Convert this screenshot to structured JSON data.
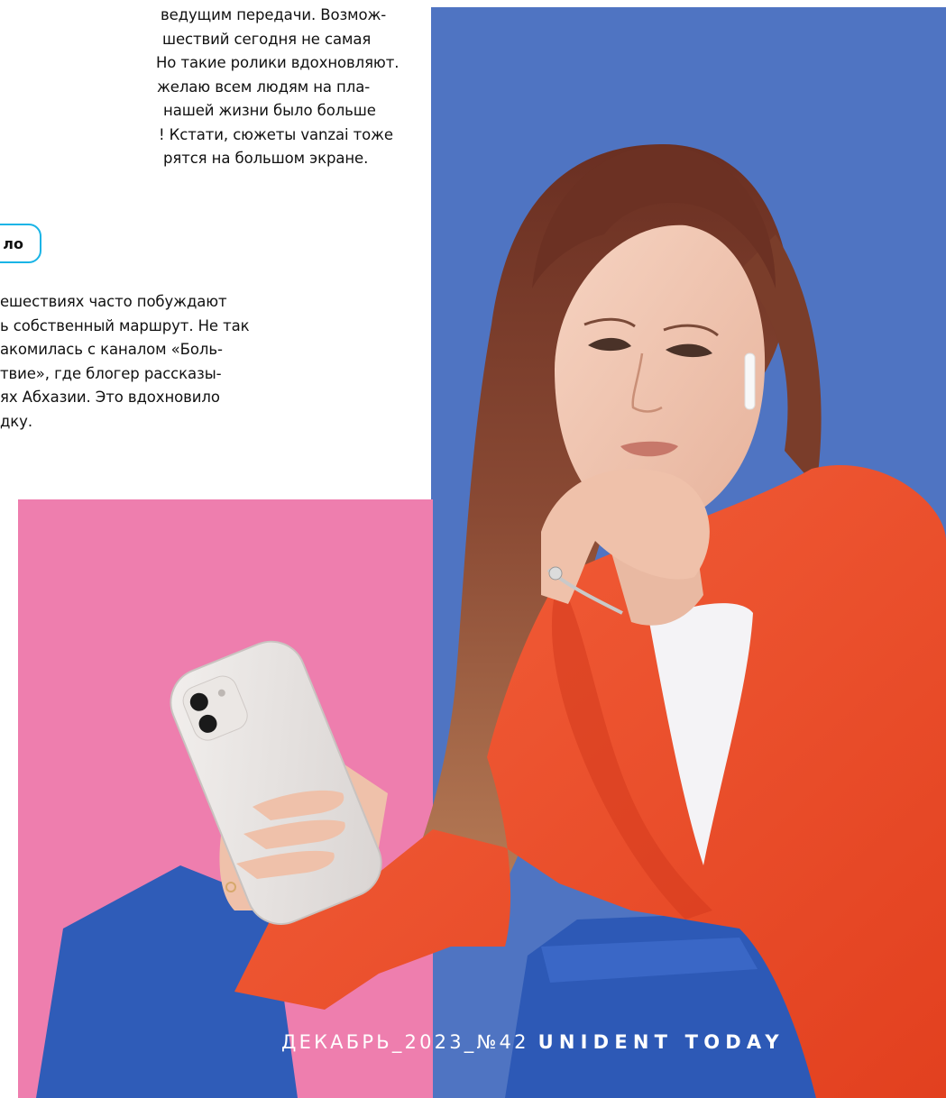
{
  "article": {
    "paragraph_1": [
      "ведущим передачи. Возмож-",
      "шествий сегодня не самая",
      "Но такие ролики вдохновляют.",
      "желаю всем людям на пла-",
      "нашей жизни было больше",
      "! Кстати, сюжеты vanzai тоже",
      "рятся на большом экране."
    ],
    "section_label": "ло",
    "paragraph_2": [
      "ешествиях часто побуждают",
      "ь собственный маршрут. Не так",
      "акомилась с каналом «Боль-",
      "твие», где блогер рассказы-",
      "ях Абхазии. Это вдохновило",
      "дку."
    ]
  },
  "footer": {
    "issue": "ДЕКАБРЬ_2023_№42",
    "brand": "UNIDENT TODAY"
  },
  "colors": {
    "accent": "#19b4e6",
    "background_blue": "#4f74c2",
    "background_pink": "#ef7fae",
    "jacket": "#f0502c"
  }
}
